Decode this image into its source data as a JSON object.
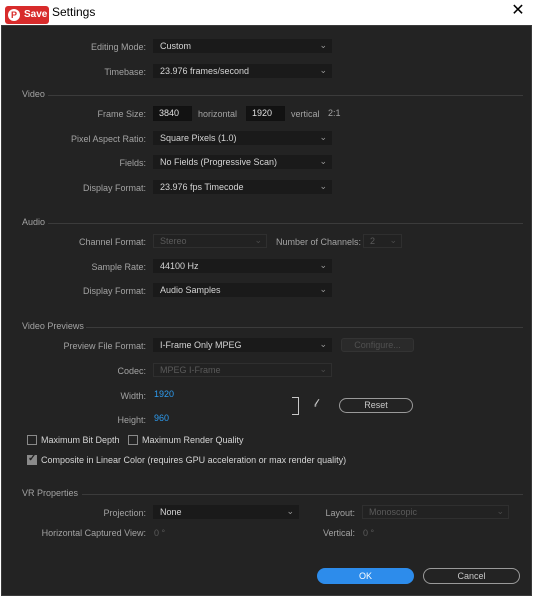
{
  "window": {
    "title": "Settings",
    "pin_label": "Save",
    "pin_icon": "pinterest-icon",
    "close_icon": "close-icon"
  },
  "general": {
    "editing_mode": {
      "label": "Editing Mode:",
      "value": "Custom"
    },
    "timebase": {
      "label": "Timebase:",
      "value": "23.976  frames/second"
    }
  },
  "video": {
    "section": "Video",
    "frame_size": {
      "label": "Frame Size:",
      "width": "3840",
      "horizontal": "horizontal",
      "height": "1920",
      "vertical": "vertical",
      "ratio": "2:1"
    },
    "pixel_aspect": {
      "label": "Pixel Aspect Ratio:",
      "value": "Square Pixels (1.0)"
    },
    "fields": {
      "label": "Fields:",
      "value": "No Fields (Progressive Scan)"
    },
    "display_format": {
      "label": "Display Format:",
      "value": "23.976 fps Timecode"
    }
  },
  "audio": {
    "section": "Audio",
    "channel_format": {
      "label": "Channel Format:",
      "value": "Stereo"
    },
    "num_channels": {
      "label": "Number of Channels:",
      "value": "2"
    },
    "sample_rate": {
      "label": "Sample Rate:",
      "value": "44100 Hz"
    },
    "display_format": {
      "label": "Display Format:",
      "value": "Audio Samples"
    }
  },
  "previews": {
    "section": "Video Previews",
    "preview_format": {
      "label": "Preview File Format:",
      "value": "I-Frame Only MPEG"
    },
    "configure_label": "Configure...",
    "codec": {
      "label": "Codec:",
      "value": "MPEG I-Frame"
    },
    "width": {
      "label": "Width:",
      "value": "1920"
    },
    "height": {
      "label": "Height:",
      "value": "960"
    },
    "reset_label": "Reset",
    "max_bit_depth": {
      "label": "Maximum Bit Depth",
      "checked": false
    },
    "max_render_quality": {
      "label": "Maximum Render Quality",
      "checked": false
    },
    "composite_linear": {
      "label": "Composite in Linear Color (requires GPU acceleration or max render quality)",
      "checked": true
    }
  },
  "vr": {
    "section": "VR Properties",
    "projection": {
      "label": "Projection:",
      "value": "None"
    },
    "layout": {
      "label": "Layout:",
      "value": "Monoscopic"
    },
    "horizontal_view": {
      "label": "Horizontal Captured View:",
      "value": "0 °"
    },
    "vertical": {
      "label": "Vertical:",
      "value": "0 °"
    }
  },
  "buttons": {
    "ok": "OK",
    "cancel": "Cancel"
  },
  "colors": {
    "accent": "#2d8ceb",
    "value_blue": "#2d9cf0",
    "background": "#232323"
  }
}
